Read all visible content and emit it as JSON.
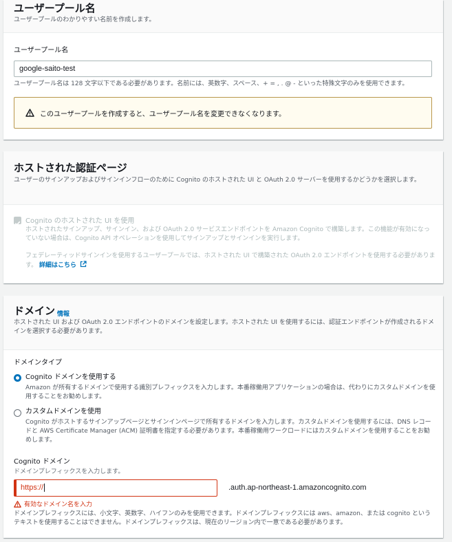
{
  "user_pool": {
    "title": "ユーザープール名",
    "description": "ユーザープールのわかりやすい名前を作成します。",
    "field_label": "ユーザープール名",
    "value": "google-saito-test",
    "constraint": "ユーザープール名は 128 文字以下である必要があります。名前には、英数字、スペース、+ = , . @ - といった特殊文字のみを使用できます。",
    "warning": "このユーザープールを作成すると、ユーザープール名を変更できなくなります。"
  },
  "hosted_ui": {
    "title": "ホストされた認証ページ",
    "description": "ユーザーのサインアップおよびサインインフローのために Cognito のホストされた UI と OAuth 2.0 サーバーを使用するかどうかを選択します。",
    "checkbox_label": "Cognito のホストされた UI を使用",
    "checkbox_desc": "ホストされたサインアップ、サインイン、および OAuth 2.0 サービスエンドポイントを Amazon Cognito で構築します。この機能が有効になっていない場合は、Cognito API オペレーションを使用してサインアップとサインインを実行します。",
    "federated_desc": "フェデレーティッドサインインを使用するユーザープールでは、ホストされた UI で構築された OAuth 2.0 エンドポイントを使用する必要があります。",
    "details_link": "詳細はこちら"
  },
  "domain": {
    "title": "ドメイン",
    "info_link": "情報",
    "description": "ホストされた UI および OAuth 2.0 エンドポイントのドメインを設定します。ホストされた UI を使用するには、認証エンドポイントが作成されるドメインを選択する必要があります。",
    "type_label": "ドメインタイプ",
    "option1_label": "Cognito ドメインを使用する",
    "option1_desc": "Amazon が所有するドメインで使用する識別プレフィックスを入力します。本番稼働用アプリケーションの場合は、代わりにカスタムドメインを使用することをお勧めします。",
    "option2_label": "カスタムドメインを使用",
    "option2_desc": "Cognito がホストするサインアップページとサインインページで所有するドメインを入力します。カスタムドメインを使用するには、DNS レコードと AWS Certificate Manager (ACM) 証明書を指定する必要があります。本番稼働用ワークロードにはカスタムドメインを使用することをお勧めします。",
    "cognito_domain_label": "Cognito ドメイン",
    "cognito_domain_desc": "ドメインプレフィックスを入力します。",
    "input_value": "https://",
    "suffix": ".auth.ap-northeast-1.amazoncognito.com",
    "error": "有効なドメイン名を入力",
    "constraint": "ドメインプレフィックスには、小文字、英数字、ハイフンのみを使用できます。ドメインプレフィックスには aws、amazon、または cognito というテキストを使用することはできません。ドメインプレフィックスは、現在のリージョン内で一意である必要があります。"
  },
  "colors": {
    "link": "#0073bb",
    "error": "#d13212",
    "warning_border": "#b8964b",
    "warning_bg": "#fffcf0"
  },
  "icons": [
    "warning-icon",
    "external-link-icon",
    "error-icon"
  ]
}
